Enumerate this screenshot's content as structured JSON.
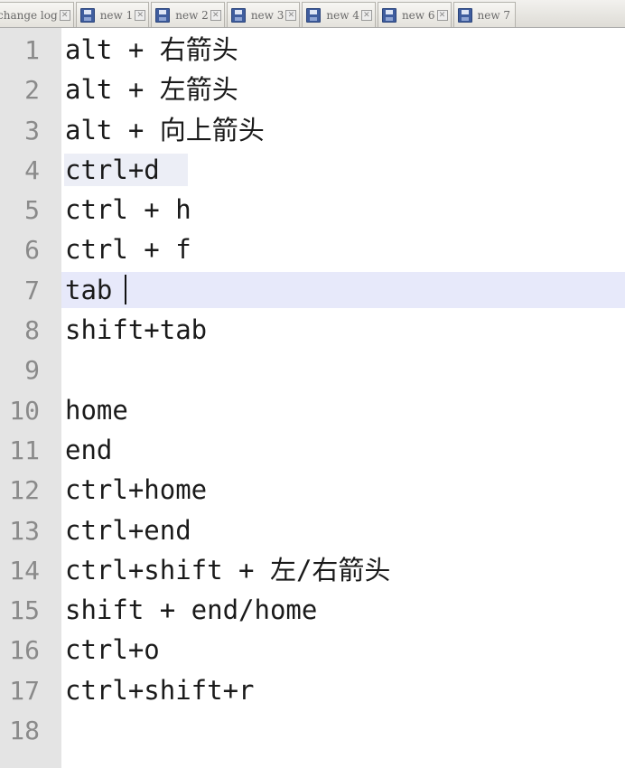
{
  "tabs": [
    {
      "label": "change log",
      "has_save_icon": false
    },
    {
      "label": "new 1",
      "has_save_icon": true
    },
    {
      "label": "new 2",
      "has_save_icon": true
    },
    {
      "label": "new 3",
      "has_save_icon": true
    },
    {
      "label": "new 4",
      "has_save_icon": true
    },
    {
      "label": "new 6",
      "has_save_icon": true
    },
    {
      "label": "new 7",
      "has_save_icon": true
    }
  ],
  "icons": {
    "tab_save": "save-disk-icon",
    "tab_close": "close-icon"
  },
  "colors": {
    "gutter": "#e4e4e4",
    "current_line": "#e7e9fa",
    "line_number": "#8a8a8a",
    "text": "#1a1a1a"
  },
  "editor": {
    "current_line": 7,
    "lines": [
      {
        "number": "1",
        "text": "alt + 右箭头"
      },
      {
        "number": "2",
        "text": "alt + 左箭头"
      },
      {
        "number": "3",
        "text": "alt + 向上箭头"
      },
      {
        "number": "4",
        "text": "ctrl+d"
      },
      {
        "number": "5",
        "text": "ctrl + h"
      },
      {
        "number": "6",
        "text": "ctrl + f"
      },
      {
        "number": "7",
        "text": "tab"
      },
      {
        "number": "8",
        "text": "shift+tab"
      },
      {
        "number": "9",
        "text": ""
      },
      {
        "number": "10",
        "text": "home"
      },
      {
        "number": "11",
        "text": "end"
      },
      {
        "number": "12",
        "text": "ctrl+home"
      },
      {
        "number": "13",
        "text": "ctrl+end"
      },
      {
        "number": "14",
        "text": "ctrl+shift + 左/右箭头"
      },
      {
        "number": "15",
        "text": "shift + end/home"
      },
      {
        "number": "16",
        "text": "ctrl+o"
      },
      {
        "number": "17",
        "text": "ctrl+shift+r"
      },
      {
        "number": "18",
        "text": ""
      }
    ]
  }
}
